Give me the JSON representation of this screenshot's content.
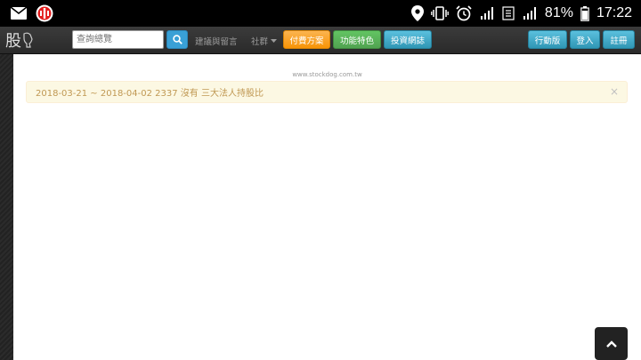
{
  "status_bar": {
    "battery_pct": "81%",
    "time": "17:22"
  },
  "navbar": {
    "logo_text": "股",
    "search_placeholder": "查詢總覽",
    "links": [
      "建議與留言",
      "社群"
    ],
    "buttons": {
      "paid": "付費方案",
      "features": "功能特色",
      "invest": "投資網誌",
      "mobile": "行動版",
      "login": "登入",
      "register": "註冊"
    }
  },
  "content": {
    "site_url": "www.stockdog.com.tw",
    "alert_text": "2018-03-21 ~ 2018-04-02 2337 沒有 三大法人持股比",
    "alert_close": "×"
  }
}
